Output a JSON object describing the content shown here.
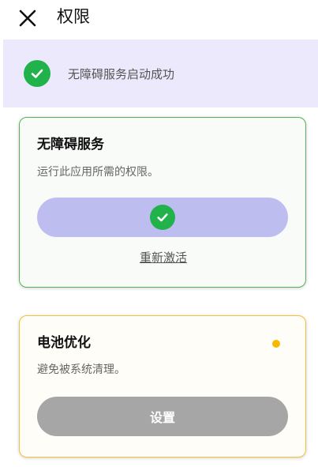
{
  "header": {
    "close_icon": "close-icon",
    "title": "权限"
  },
  "banner": {
    "icon": "check-circle-icon",
    "text": "无障碍服务启动成功",
    "icon_color": "#22b24c",
    "background": "#ebe9fb"
  },
  "cards": [
    {
      "title": "无障碍服务",
      "description": "运行此应用所需的权限。",
      "status": "granted",
      "button_icon": "check-circle-icon",
      "link_label": "重新激活",
      "border_color": "#57b357",
      "button_color": "#bebdf0"
    },
    {
      "title": "电池优化",
      "description": "避免被系统清理。",
      "status": "pending",
      "status_indicator": "status-dot-icon",
      "button_label": "设置",
      "border_color": "#f3c23a",
      "button_color": "#a6a6a6",
      "dot_color": "#f7b800"
    }
  ]
}
